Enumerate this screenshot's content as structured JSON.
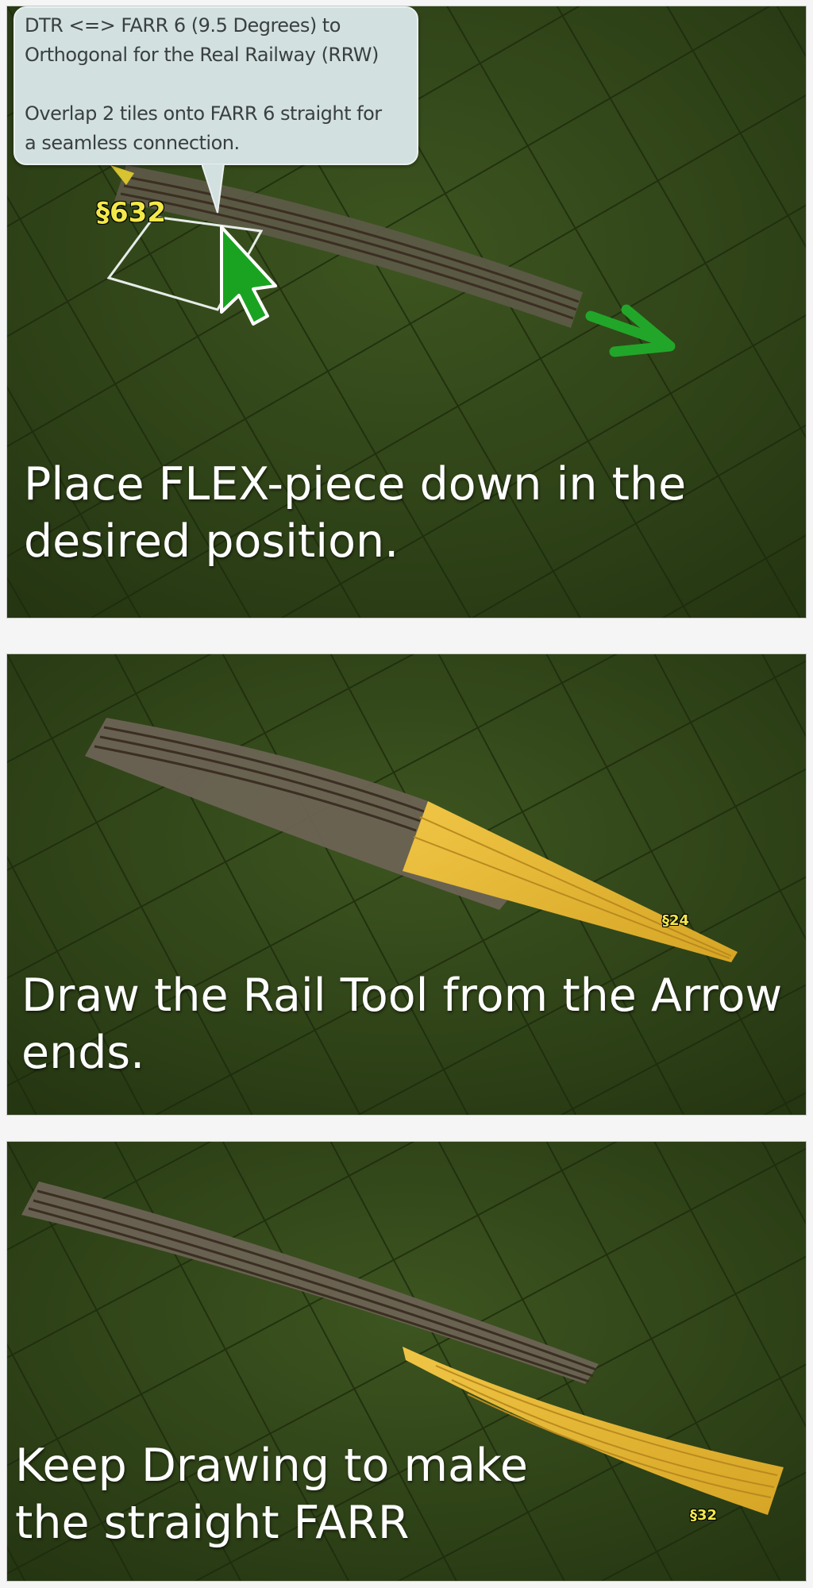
{
  "panels": [
    {
      "caption": "Place FLEX-piece down in the\ndesired position.",
      "tooltip": {
        "line1": "DTR <=> FARR 6 (9.5 Degrees) to",
        "line2": "Orthogonal for the Real Railway (RRW)",
        "line3": "Overlap 2 tiles onto FARR 6 straight for",
        "line4": "a seamless connection."
      },
      "tile_label": "§632",
      "icons": [
        "green-cursor-arrow-icon",
        "green-direction-arrow-icon"
      ]
    },
    {
      "caption": "Draw the Rail Tool from the Arrow\nends.",
      "tile_label": "§24"
    },
    {
      "caption": "Keep Drawing to make\nthe straight FARR",
      "tile_label": "§32"
    }
  ],
  "colors": {
    "grass": "#2f4217",
    "track_bed": "#6b6354",
    "track_highlight": "#e7b52f",
    "tooltip_bg": "#d2e0e0",
    "cursor_green": "#1aa321",
    "label_yellow": "#f2e84a"
  }
}
